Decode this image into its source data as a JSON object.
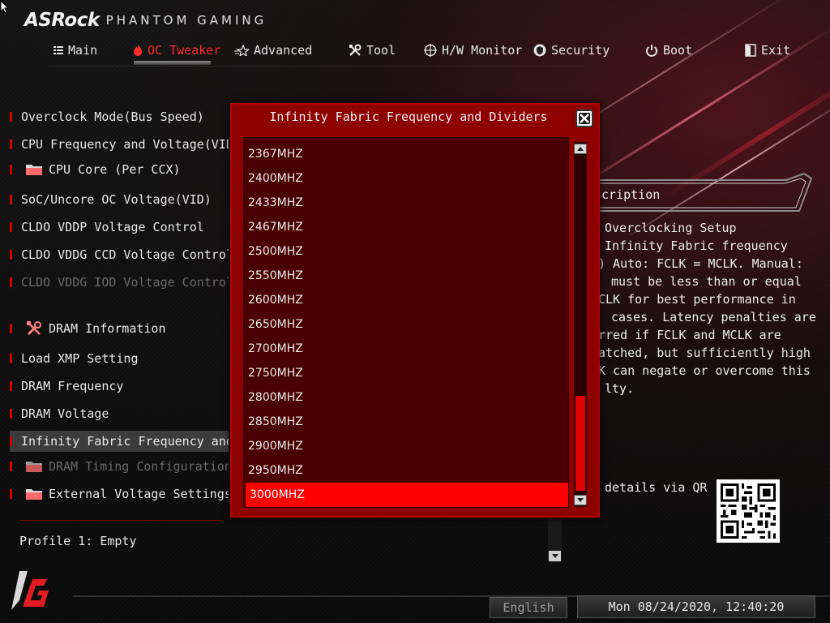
{
  "brand": {
    "name": "ASRock",
    "sub": "PHANTOM GAMING"
  },
  "menu": [
    {
      "label": "Main",
      "icon": "list-icon"
    },
    {
      "label": "OC Tweaker",
      "icon": "flame-icon",
      "active": true
    },
    {
      "label": "Advanced",
      "icon": "star-icon"
    },
    {
      "label": "Tool",
      "icon": "tools-icon"
    },
    {
      "label": "H/W Monitor",
      "icon": "crosshair-icon"
    },
    {
      "label": "Security",
      "icon": "shield-icon"
    },
    {
      "label": "Boot",
      "icon": "power-icon"
    },
    {
      "label": "Exit",
      "icon": "exit-icon"
    }
  ],
  "options": [
    {
      "label": "Overclock Mode(Bus Speed)"
    },
    {
      "label": "CPU Frequency and Voltage(VID) Ch"
    },
    {
      "label": "CPU Core (Per CCX)",
      "icon": "folder-icon"
    },
    {
      "label": "SoC/Uncore OC Voltage(VID)"
    },
    {
      "label": "CLDO VDDP Voltage Control"
    },
    {
      "label": "CLDO VDDG CCD Voltage Control"
    },
    {
      "label": "CLDO VDDG IOD Voltage Control",
      "disabled": true
    },
    {
      "label": "DRAM Information",
      "icon": "tools-icon"
    },
    {
      "label": "Load XMP Setting"
    },
    {
      "label": "DRAM Frequency"
    },
    {
      "label": "DRAM Voltage"
    },
    {
      "label": "Infinity Fabric Frequency and Di",
      "selected": true
    },
    {
      "label": "DRAM Timing Configuration",
      "icon": "folder-icon",
      "disabled": true
    },
    {
      "label": "External Voltage Settings and",
      "icon": "folder-icon"
    }
  ],
  "profile": "Profile 1: Empty",
  "description": {
    "title": "scription",
    "lines": [
      "Overclocking Setup",
      "Infinity Fabric frequency",
      ") Auto: FCLK = MCLK. Manual:",
      "must be less than or equal",
      "CLK for best performance in",
      "cases. Latency penalties are",
      "rred if FCLK and MCLK are",
      "atched, but sufficiently high",
      "K can negate or overcome this",
      "lty."
    ],
    "qr_label": "details via QR"
  },
  "modal": {
    "title": "Infinity Fabric Frequency and Dividers",
    "items": [
      "2367MHZ",
      "2400MHZ",
      "2433MHZ",
      "2467MHZ",
      "2500MHZ",
      "2550MHZ",
      "2600MHZ",
      "2650MHZ",
      "2700MHZ",
      "2750MHZ",
      "2800MHZ",
      "2850MHZ",
      "2900MHZ",
      "2950MHZ",
      "3000MHZ"
    ],
    "selected": "3000MHZ"
  },
  "footer": {
    "language": "English",
    "datetime": "Mon 08/24/2020, 12:40:20"
  },
  "colors": {
    "accent": "#ff0000",
    "modal_bg": "#8e0000",
    "list_bg": "#4a0000"
  }
}
